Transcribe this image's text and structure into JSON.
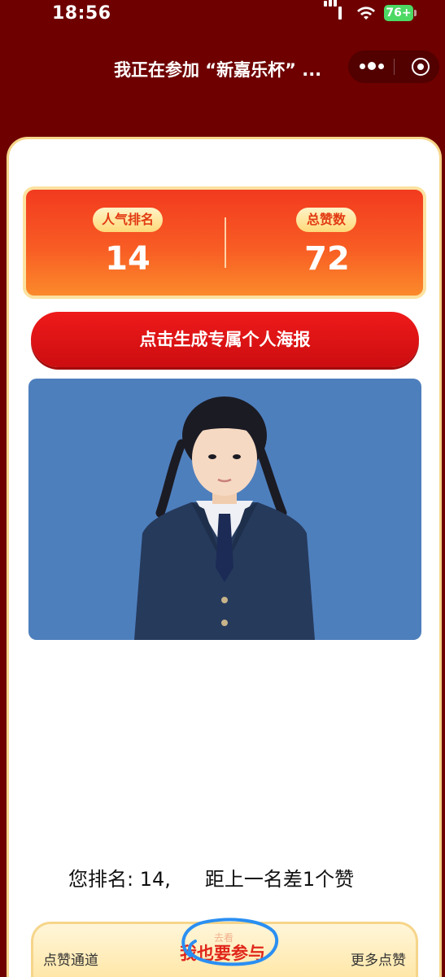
{
  "status_bar": {
    "time": "18:56",
    "battery": "76+"
  },
  "nav": {
    "title": "我正在参加 “新嘉乐杯” ...",
    "more_icon": "more-dots-icon",
    "close_icon": "target-close-icon"
  },
  "stats": {
    "rank_label": "人气排名",
    "rank_value": "14",
    "likes_label": "总赞数",
    "likes_value": "72"
  },
  "poster_button": "点击生成专属个人海报",
  "photo": {
    "background_color": "#4e7fbd"
  },
  "rank_info": {
    "rank_text": "您排名: 14,",
    "gap_text": "距上一名差1个赞"
  },
  "bottom_bar": {
    "left_tab": "点赞通道",
    "center_button": "我也要参与",
    "center_small": "去看",
    "right_tab": "更多点赞"
  },
  "colors": {
    "page_background": "#6e0000",
    "accent_red": "#e0261a",
    "gold_border": "#f6d58a"
  }
}
